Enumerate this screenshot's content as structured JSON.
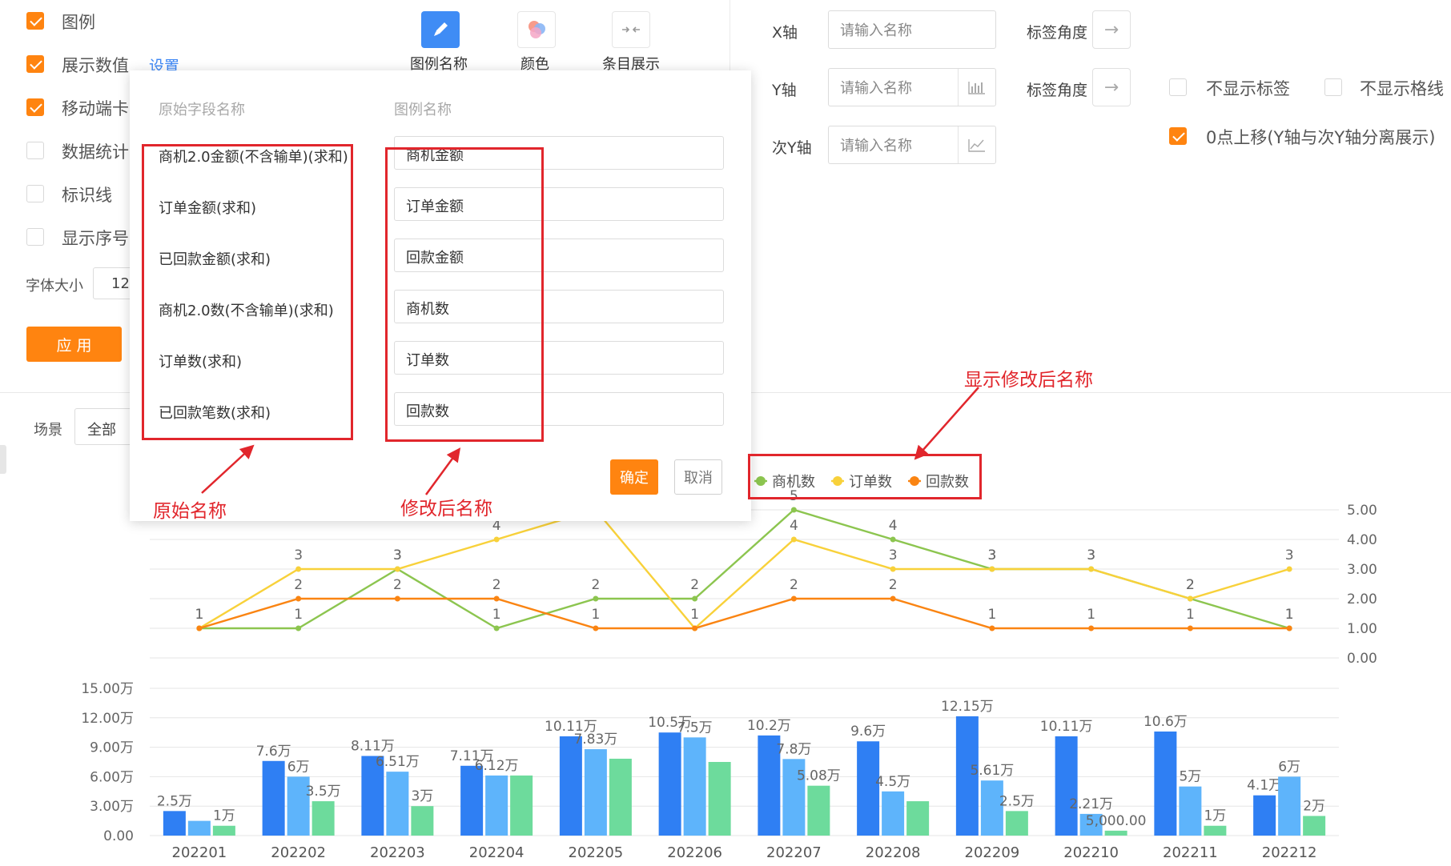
{
  "left_panel": {
    "options": [
      {
        "label": "图例",
        "checked": true
      },
      {
        "label": "展示数值",
        "checked": true,
        "link": "设置"
      },
      {
        "label": "移动端卡",
        "checked": true
      },
      {
        "label": "数据统计",
        "checked": false
      },
      {
        "label": "标识线",
        "checked": false
      },
      {
        "label": "显示序号",
        "checked": false
      }
    ],
    "font_size_label": "字体大小",
    "font_size_value": "12",
    "apply_button": "应 用",
    "scene_label": "场景",
    "scene_value": "全部"
  },
  "toolbar": {
    "legend_name": {
      "label": "图例名称",
      "icon": "pencil-icon"
    },
    "color": {
      "label": "颜色",
      "icon": "color-palette-icon"
    },
    "item_display": {
      "label": "条目展示",
      "icon": "collapse-arrows-icon"
    }
  },
  "axis_settings": {
    "x_axis": {
      "label": "X轴",
      "placeholder": "请输入名称",
      "angle_label": "标签角度"
    },
    "y_axis": {
      "label": "Y轴",
      "placeholder": "请输入名称",
      "angle_label": "标签角度"
    },
    "y2_axis": {
      "label": "次Y轴",
      "placeholder": "请输入名称"
    },
    "hide_labels": {
      "label": "不显示标签",
      "checked": false
    },
    "hide_grid": {
      "label": "不显示格线",
      "checked": false
    },
    "zero_shift": {
      "label": "0点上移(Y轴与次Y轴分离展示)",
      "checked": true
    }
  },
  "modal": {
    "col_original": "原始字段名称",
    "col_legend": "图例名称",
    "rows": [
      {
        "original": "商机2.0金额(不含输单)(求和)",
        "legend": "商机金额"
      },
      {
        "original": "订单金额(求和)",
        "legend": "订单金额"
      },
      {
        "original": "已回款金额(求和)",
        "legend": "回款金额"
      },
      {
        "original": "商机2.0数(不含输单)(求和)",
        "legend": "商机数"
      },
      {
        "original": "订单数(求和)",
        "legend": "订单数"
      },
      {
        "original": "已回款笔数(求和)",
        "legend": "回款数"
      }
    ],
    "confirm": "确定",
    "cancel": "取消"
  },
  "annotations": {
    "original_name": "原始名称",
    "modified_name": "修改后名称",
    "show_modified": "显示修改后名称"
  },
  "colors": {
    "accent": "#ff8410",
    "annotation_red": "#e1262c",
    "bar1": "#2f7ff3",
    "bar2": "#5eb4fb",
    "bar3": "#6ddb9c",
    "line_green": "#8cc54f",
    "line_yellow": "#f8d13a",
    "line_orange": "#fa8412"
  },
  "chart_data": {
    "type": "bar+line",
    "categories": [
      "202201",
      "202202",
      "202203",
      "202204",
      "202205",
      "202206",
      "202207",
      "202208",
      "202209",
      "202210",
      "202211",
      "202212"
    ],
    "legend": [
      "商机数",
      "订单数",
      "回款数"
    ],
    "line_series": [
      {
        "name": "商机数",
        "values": [
          1,
          1,
          3,
          1,
          2,
          2,
          5,
          4,
          3,
          3,
          2,
          1
        ],
        "labels": [
          "1",
          "1",
          "3",
          "1",
          "2",
          "2",
          "5",
          "4",
          "3",
          "3",
          "2",
          "1"
        ]
      },
      {
        "name": "订单数",
        "values": [
          1,
          3,
          3,
          4,
          5,
          1,
          4,
          3,
          3,
          3,
          2,
          3
        ],
        "labels": [
          "",
          "3",
          "3",
          "4",
          "",
          "",
          "4",
          "3",
          "3",
          "3",
          "2",
          "3"
        ]
      },
      {
        "name": "回款数",
        "values": [
          1,
          2,
          2,
          2,
          1,
          1,
          2,
          2,
          1,
          1,
          1,
          1
        ],
        "labels": [
          "1",
          "2",
          "2",
          "2",
          "1",
          "1",
          "2",
          "2",
          "1",
          "1",
          "1",
          "1"
        ]
      }
    ],
    "line_axis": {
      "min": 0,
      "max": 5,
      "ticks": [
        "0.00",
        "1.00",
        "2.00",
        "3.00",
        "4.00",
        "5.00"
      ]
    },
    "bar_series": [
      {
        "values": [
          2.5,
          7.6,
          8.11,
          7.11,
          10.11,
          10.5,
          10.2,
          9.6,
          12.15,
          10.11,
          10.6,
          4.1
        ],
        "labels": [
          "2.5万",
          "7.6万",
          "8.11万",
          "7.11万",
          "10.11万",
          "10.5万",
          "10.2万",
          "9.6万",
          "12.15万",
          "10.11万",
          "10.6万",
          "4.1万"
        ]
      },
      {
        "values": [
          1.5,
          6,
          6.51,
          6.12,
          8.8,
          10,
          7.8,
          4.5,
          5.61,
          2.21,
          5,
          6
        ],
        "labels": [
          "",
          "6万",
          "6.51万",
          "6.12万",
          "7.83万",
          "7.5万",
          "7.8万",
          "4.5万",
          "5.61万",
          "2.21万",
          "5万",
          "6万"
        ]
      },
      {
        "values": [
          1,
          3.5,
          3,
          6.12,
          7.83,
          7.5,
          5.08,
          3.5,
          2.5,
          0.5,
          1,
          2
        ],
        "labels": [
          "1万",
          "3.5万",
          "3万",
          "",
          "",
          "",
          "5.08万",
          "",
          "2.5万",
          "5,000.00",
          "1万",
          "2万"
        ]
      }
    ],
    "bar_axis": {
      "min": 0,
      "max": 15,
      "ticks": [
        "0.00",
        "3.00万",
        "6.00万",
        "9.00万",
        "12.00万",
        "15.00万"
      ]
    }
  }
}
